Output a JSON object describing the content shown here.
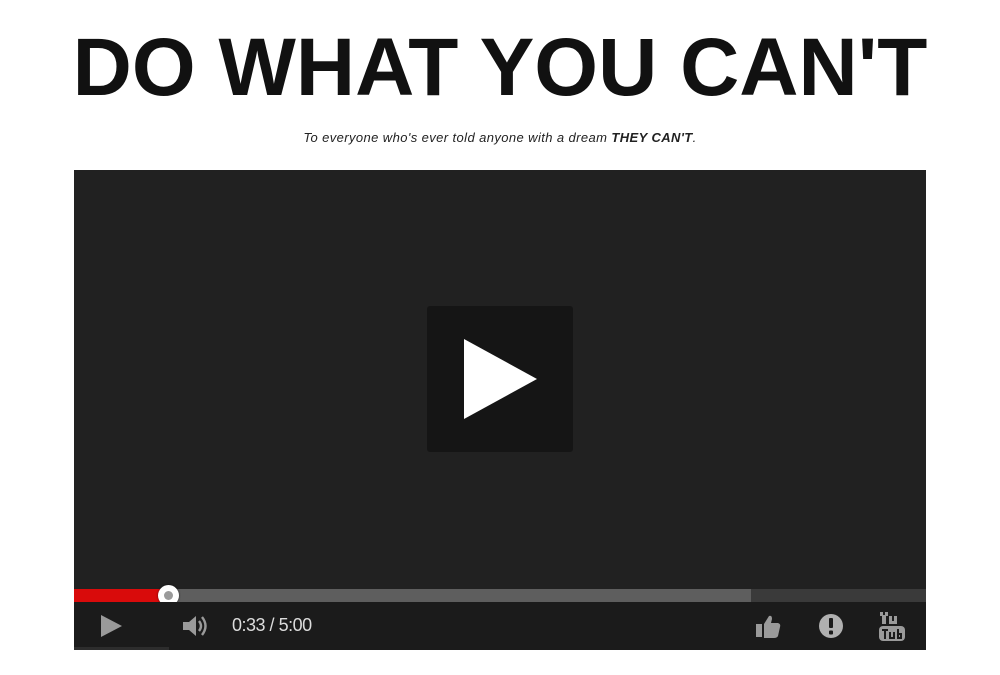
{
  "header": {
    "title": "DO WHAT YOU CAN'T",
    "subtitle_prefix": "To everyone who's ever told anyone with a dream ",
    "subtitle_emphasis": "THEY CAN'T",
    "subtitle_suffix": "."
  },
  "player": {
    "current_time": "0:33",
    "separator": " / ",
    "duration": "5:00",
    "played_fraction": 0.11,
    "buffered_fraction": 0.795,
    "icons": {
      "big_play": "play-icon",
      "play": "play-icon",
      "volume": "volume-icon",
      "like": "thumbs-up-icon",
      "report": "exclamation-icon",
      "logo": "youtube-logo-icon"
    },
    "colors": {
      "progress_played": "#d90b0b",
      "player_background": "#212121"
    }
  }
}
